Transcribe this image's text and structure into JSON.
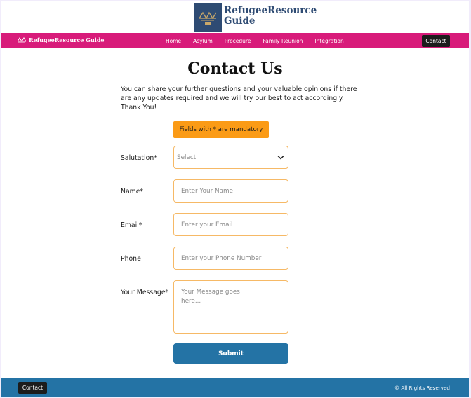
{
  "brand": {
    "title_line1": "RefugeeResource",
    "title_line2": "Guide"
  },
  "nav": {
    "logo_text": "RefugeeResource Guide",
    "links": [
      "Home",
      "Asylum",
      "Procedure",
      "Family Reunion",
      "Integration"
    ],
    "contact_label": "Contact"
  },
  "main": {
    "title": "Contact Us",
    "intro": "You can share your further questions and your valuable opinions if there are any updates required and we will try our best to act accordingly. Thank You!",
    "mandatory_note": "Fields with * are mandatory"
  },
  "form": {
    "salutation_label": "Salutation*",
    "salutation_value": "Select",
    "name_label": "Name*",
    "name_placeholder": "Enter Your Name",
    "email_label": "Email*",
    "email_placeholder": "Enter your Email",
    "phone_label": "Phone",
    "phone_placeholder": "Enter your Phone Number",
    "message_label": "Your Message*",
    "message_placeholder": "Your Message goes here...",
    "submit_label": "Submit"
  },
  "footer": {
    "contact_label": "Contact",
    "rights": "© All Rights Reserved"
  },
  "colors": {
    "nav_bg": "#d81b7a",
    "brand_blue": "#2e4b73",
    "footer_bg": "#2473a5",
    "accent_orange": "#fb9b16"
  }
}
